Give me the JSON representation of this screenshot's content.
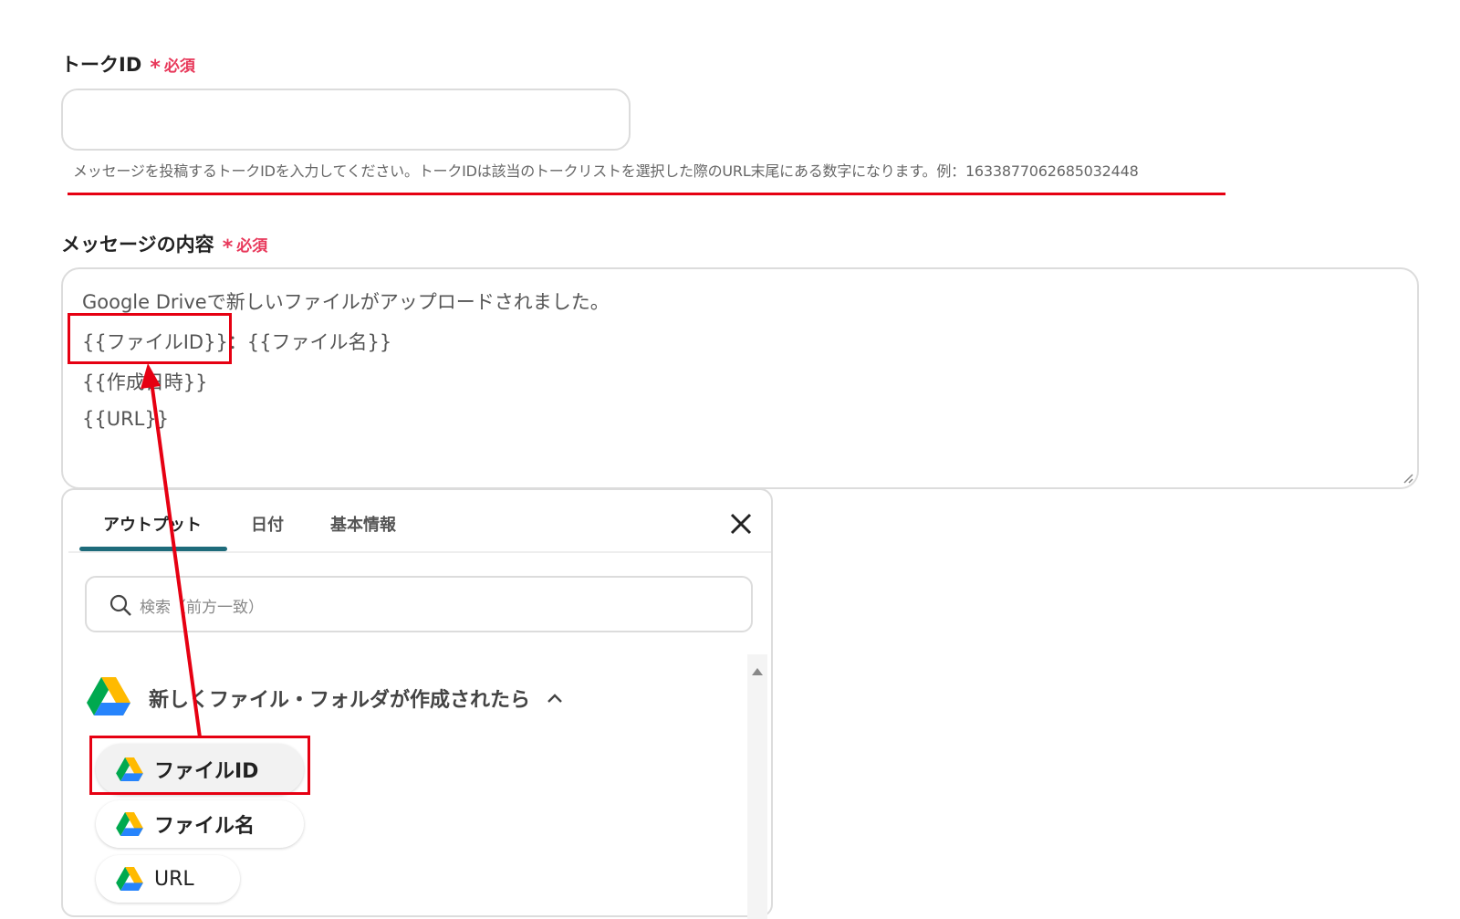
{
  "talk_id": {
    "label": "トークID",
    "required": "必須",
    "value": "",
    "help": "メッセージを投稿するトークIDを入力してください。トークIDは該当のトークリストを選択した際のURL末尾にある数字になります。例：1633877062685032448"
  },
  "message": {
    "label": "メッセージの内容",
    "required": "必須",
    "lines": [
      "Google Driveで新しいファイルがアップロードされました。",
      "{{ファイルID}}：{{ファイル名}}",
      "{{作成日時}}",
      "{{URL}}"
    ]
  },
  "picker": {
    "tabs": [
      "アウトプット",
      "日付",
      "基本情報"
    ],
    "active_tab": 0,
    "search_placeholder": "検索（前方一致）",
    "section_title": "新しくファイル・フォルダが作成されたら",
    "items": [
      "ファイルID",
      "ファイル名",
      "URL"
    ]
  },
  "colors": {
    "accent_tab": "#1e6b7b",
    "required": "#e8385a",
    "annotation": "#e60012"
  }
}
